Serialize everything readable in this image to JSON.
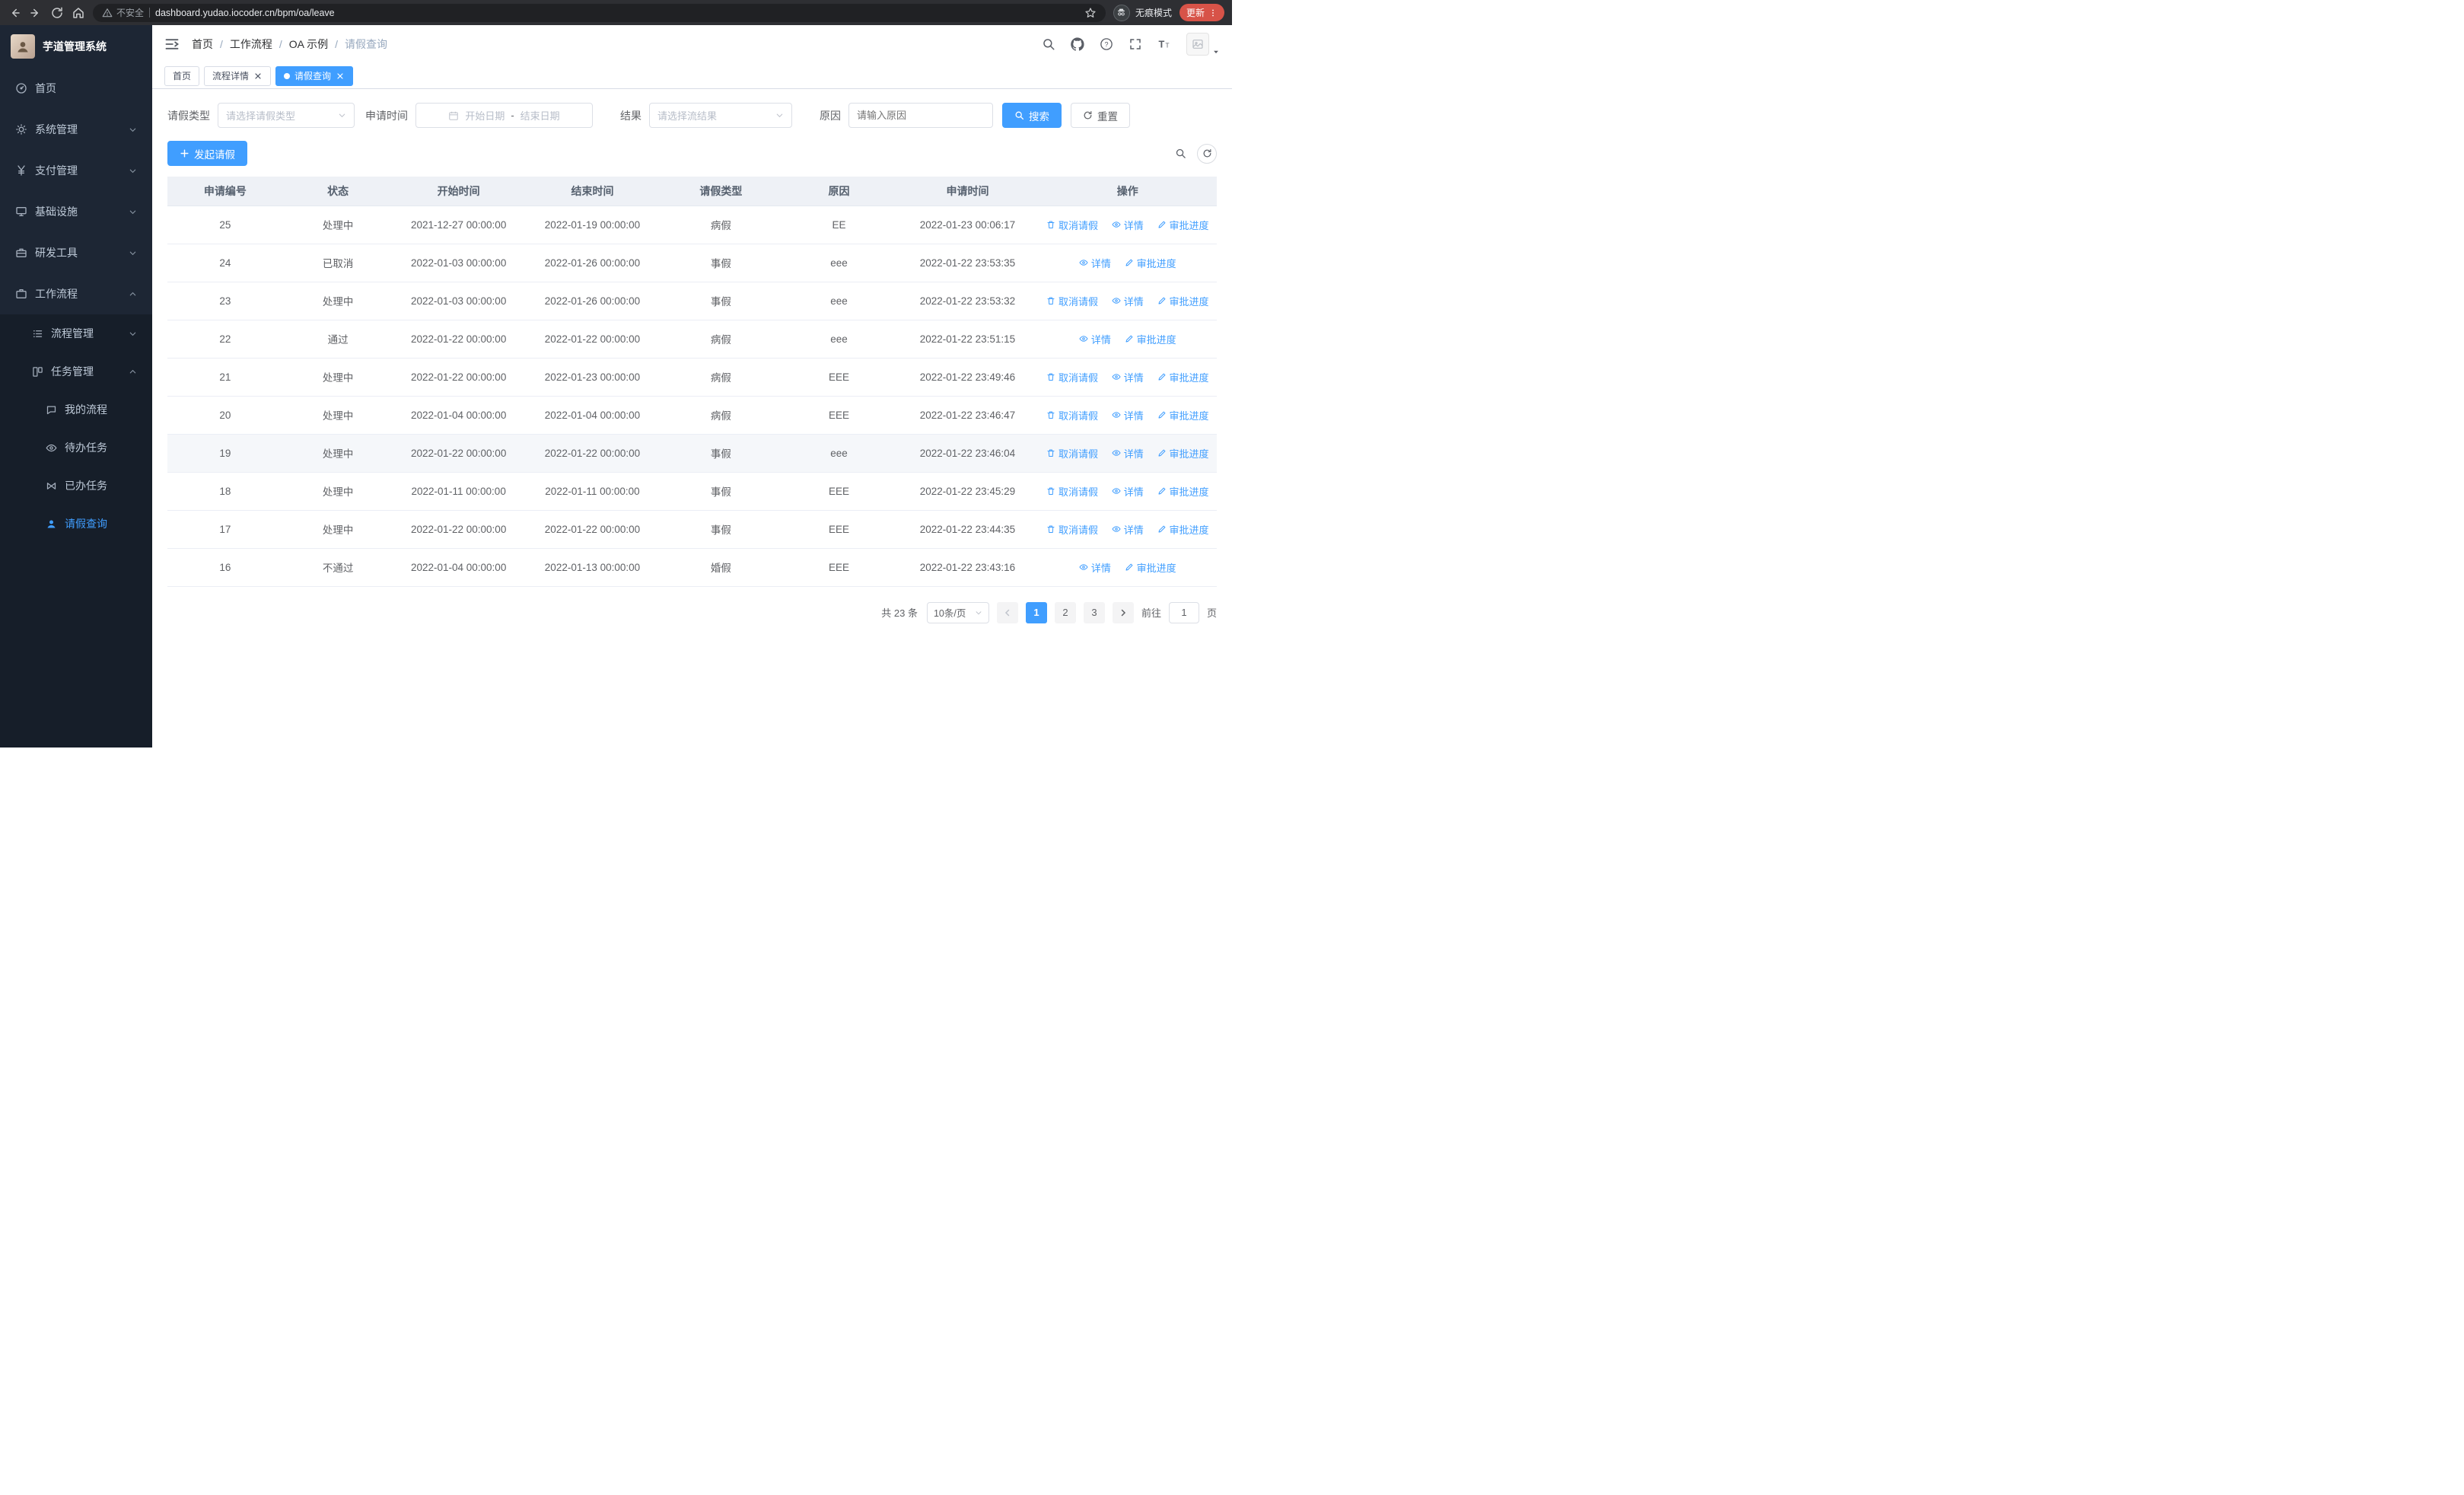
{
  "browser": {
    "security_warning": "不安全",
    "url": "dashboard.yudao.iocoder.cn/bpm/oa/leave",
    "incognito_label": "无痕模式",
    "update_label": "更新"
  },
  "sidebar": {
    "title": "芋道管理系统",
    "items": [
      {
        "label": "首页"
      },
      {
        "label": "系统管理"
      },
      {
        "label": "支付管理"
      },
      {
        "label": "基础设施"
      },
      {
        "label": "研发工具"
      },
      {
        "label": "工作流程"
      }
    ],
    "workflow_children": [
      {
        "label": "流程管理"
      },
      {
        "label": "任务管理"
      }
    ],
    "task_children": [
      {
        "label": "我的流程"
      },
      {
        "label": "待办任务"
      },
      {
        "label": "已办任务"
      },
      {
        "label": "请假查询"
      }
    ]
  },
  "header": {
    "breadcrumb": [
      "首页",
      "工作流程",
      "OA 示例",
      "请假查询"
    ]
  },
  "tabs": [
    {
      "label": "首页"
    },
    {
      "label": "流程详情"
    },
    {
      "label": "请假查询"
    }
  ],
  "filters": {
    "leave_type_label": "请假类型",
    "leave_type_placeholder": "请选择请假类型",
    "apply_time_label": "申请时间",
    "start_date_placeholder": "开始日期",
    "date_separator": "-",
    "end_date_placeholder": "结束日期",
    "result_label": "结果",
    "result_placeholder": "请选择流结果",
    "reason_label": "原因",
    "reason_placeholder": "请输入原因",
    "search_label": "搜索",
    "reset_label": "重置"
  },
  "toolbar": {
    "create_label": "发起请假"
  },
  "table": {
    "columns": [
      "申请编号",
      "状态",
      "开始时间",
      "结束时间",
      "请假类型",
      "原因",
      "申请时间",
      "操作"
    ],
    "action_labels": {
      "cancel": "取消请假",
      "detail": "详情",
      "progress": "审批进度"
    },
    "rows": [
      {
        "no": "25",
        "status": "处理中",
        "start": "2021-12-27 00:00:00",
        "end": "2022-01-19 00:00:00",
        "type": "病假",
        "reason": "EE",
        "applied": "2022-01-23 00:06:17",
        "cancellable": true,
        "highlighted": false
      },
      {
        "no": "24",
        "status": "已取消",
        "start": "2022-01-03 00:00:00",
        "end": "2022-01-26 00:00:00",
        "type": "事假",
        "reason": "eee",
        "applied": "2022-01-22 23:53:35",
        "cancellable": false,
        "highlighted": false
      },
      {
        "no": "23",
        "status": "处理中",
        "start": "2022-01-03 00:00:00",
        "end": "2022-01-26 00:00:00",
        "type": "事假",
        "reason": "eee",
        "applied": "2022-01-22 23:53:32",
        "cancellable": true,
        "highlighted": false
      },
      {
        "no": "22",
        "status": "通过",
        "start": "2022-01-22 00:00:00",
        "end": "2022-01-22 00:00:00",
        "type": "病假",
        "reason": "eee",
        "applied": "2022-01-22 23:51:15",
        "cancellable": false,
        "highlighted": false
      },
      {
        "no": "21",
        "status": "处理中",
        "start": "2022-01-22 00:00:00",
        "end": "2022-01-23 00:00:00",
        "type": "病假",
        "reason": "EEE",
        "applied": "2022-01-22 23:49:46",
        "cancellable": true,
        "highlighted": false
      },
      {
        "no": "20",
        "status": "处理中",
        "start": "2022-01-04 00:00:00",
        "end": "2022-01-04 00:00:00",
        "type": "病假",
        "reason": "EEE",
        "applied": "2022-01-22 23:46:47",
        "cancellable": true,
        "highlighted": false
      },
      {
        "no": "19",
        "status": "处理中",
        "start": "2022-01-22 00:00:00",
        "end": "2022-01-22 00:00:00",
        "type": "事假",
        "reason": "eee",
        "applied": "2022-01-22 23:46:04",
        "cancellable": true,
        "highlighted": true
      },
      {
        "no": "18",
        "status": "处理中",
        "start": "2022-01-11 00:00:00",
        "end": "2022-01-11 00:00:00",
        "type": "事假",
        "reason": "EEE",
        "applied": "2022-01-22 23:45:29",
        "cancellable": true,
        "highlighted": false
      },
      {
        "no": "17",
        "status": "处理中",
        "start": "2022-01-22 00:00:00",
        "end": "2022-01-22 00:00:00",
        "type": "事假",
        "reason": "EEE",
        "applied": "2022-01-22 23:44:35",
        "cancellable": true,
        "highlighted": false
      },
      {
        "no": "16",
        "status": "不通过",
        "start": "2022-01-04 00:00:00",
        "end": "2022-01-13 00:00:00",
        "type": "婚假",
        "reason": "EEE",
        "applied": "2022-01-22 23:43:16",
        "cancellable": false,
        "highlighted": false
      }
    ]
  },
  "pagination": {
    "total_text": "共 23 条",
    "page_size": "10条/页",
    "pages": [
      "1",
      "2",
      "3"
    ],
    "active_page": "1",
    "goto_label": "前往",
    "goto_value": "1",
    "unit_label": "页"
  },
  "colors": {
    "primary": "#409eff",
    "sidebar_bg": "#1d2634",
    "sidebar_sub_bg": "#161e29",
    "chrome_bg": "#2e2f33",
    "update_pill": "#d75348"
  }
}
